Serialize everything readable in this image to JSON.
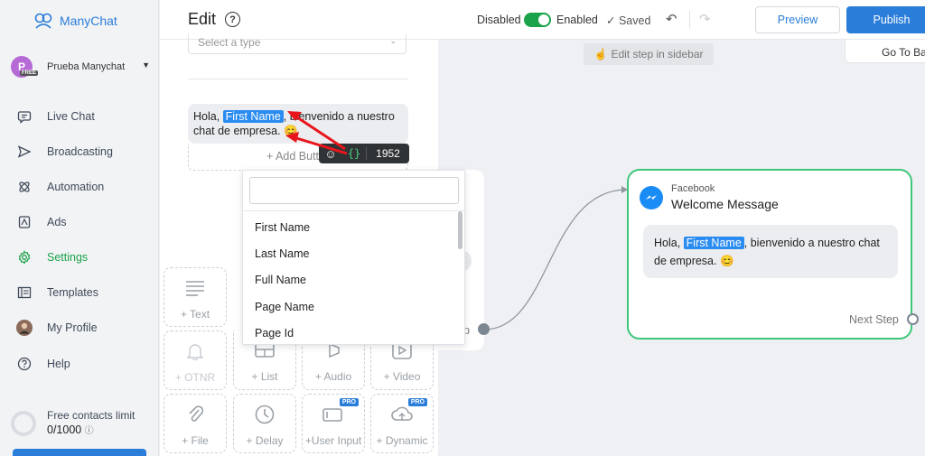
{
  "app": {
    "name": "ManyChat"
  },
  "workspace": {
    "initial": "P",
    "badge": "FREE",
    "name": "Prueba Manychat"
  },
  "sidebar": {
    "items": [
      {
        "label": "Live Chat",
        "icon": "chat-icon"
      },
      {
        "label": "Broadcasting",
        "icon": "send-icon"
      },
      {
        "label": "Automation",
        "icon": "automation-icon"
      },
      {
        "label": "Ads",
        "icon": "ads-icon"
      },
      {
        "label": "Settings",
        "icon": "gear-icon",
        "active": true
      },
      {
        "label": "Templates",
        "icon": "templates-icon"
      },
      {
        "label": "My Profile",
        "icon": "avatar-icon"
      },
      {
        "label": "Help",
        "icon": "help-icon"
      }
    ],
    "contacts_limit_label": "Free contacts limit",
    "contacts_limit_value": "0/1000"
  },
  "header": {
    "title": "Edit",
    "help": "?",
    "disabled_label": "Disabled",
    "enabled_label": "Enabled",
    "toggle_on": true,
    "saved_label": "Saved",
    "preview_label": "Preview",
    "publish_label": "Publish",
    "goto_label": "Go To Ba"
  },
  "canvas": {
    "hint": "Edit step in sidebar",
    "ghost_label": "ep"
  },
  "editor": {
    "type_placeholder": "Select a type",
    "message": {
      "before": "Hola, ",
      "variable": "First Name",
      "after": ", bienvenido a nuestro chat de empresa. "
    },
    "add_button": "+ Add Butt",
    "char_count": "1952",
    "tiles": [
      {
        "label": "+ Text",
        "icon": "text-icon"
      },
      {
        "label": "+ OTNR",
        "icon": "bell-icon"
      },
      {
        "label": "+ List",
        "icon": "list-icon"
      },
      {
        "label": "+ Audio",
        "icon": "audio-icon"
      },
      {
        "label": "+ Video",
        "icon": "video-icon"
      },
      {
        "label": "+ File",
        "icon": "paperclip-icon"
      },
      {
        "label": "+ Delay",
        "icon": "clock-icon"
      },
      {
        "label": "+User Input",
        "icon": "user-input-icon",
        "pro": "PRO"
      },
      {
        "label": "+ Dynamic",
        "icon": "cloud-icon",
        "pro": "PRO"
      }
    ]
  },
  "dropdown": {
    "search_value": "",
    "items": [
      "First Name",
      "Last Name",
      "Full Name",
      "Page Name",
      "Page Id"
    ]
  },
  "fb_node": {
    "platform": "Facebook",
    "title": "Welcome Message",
    "message": {
      "before": "Hola, ",
      "variable": "First Name",
      "after": ", bienvenido a nuestro chat de empresa. "
    },
    "next_step": "Next Step"
  },
  "colors": {
    "accent": "#2a7dd9",
    "active": "#1aa34a",
    "variable": "#2a8cf0",
    "node_border": "#3ec77a"
  }
}
